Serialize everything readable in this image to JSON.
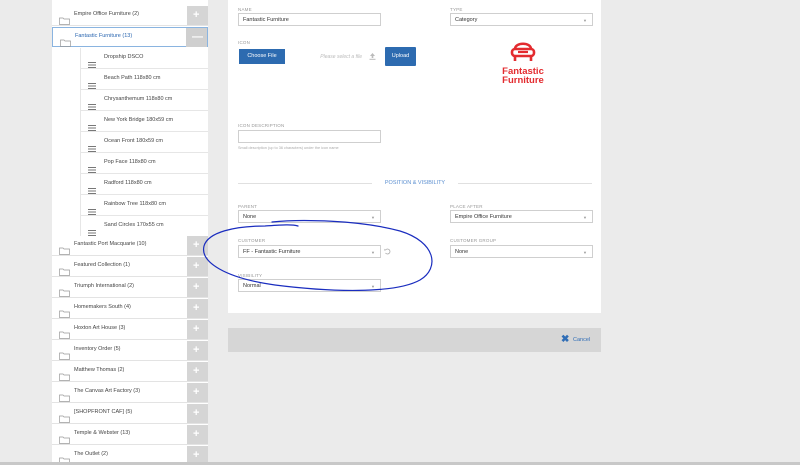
{
  "colors": {
    "accent": "#2d6bb0",
    "logo_red": "#e32b2f",
    "annotation_ink": "#1a2dbf"
  },
  "sidebar": {
    "categories_top": [
      {
        "label": "Empire Office Furniture (2)",
        "toggle": "+"
      },
      {
        "label": "Fantastic Furniture (13)",
        "toggle": "—",
        "active": true
      }
    ],
    "items": [
      "Dropship DSCO",
      "Beach Path 118x80 cm",
      "Chrysanthemum 118x80 cm",
      "New York Bridge 180x59 cm",
      "Ocean Front 180x59 cm",
      "Pop Face 118x80 cm",
      "Radford 118x80 cm",
      "Rainbow Tree 118x80 cm",
      "Sand Circles 170x55 cm"
    ],
    "categories_bottom": [
      {
        "label": "Fantastic Port Macquarie (10)",
        "toggle": "+"
      },
      {
        "label": "Featured Collection (1)",
        "toggle": "+"
      },
      {
        "label": "Triumph International (2)",
        "toggle": "+"
      },
      {
        "label": "Homemakers South (4)",
        "toggle": "+"
      },
      {
        "label": "Hoxton Art House (3)",
        "toggle": "+"
      },
      {
        "label": "Inventory Order (5)",
        "toggle": "+"
      },
      {
        "label": "Matthew Thomas (2)",
        "toggle": "+"
      },
      {
        "label": "The Canvas Art Factory (3)",
        "toggle": "+"
      },
      {
        "label": "[SHOPFRONT CAF] (5)",
        "toggle": "+"
      },
      {
        "label": "Temple & Webster (13)",
        "toggle": "+"
      },
      {
        "label": "The Outlet (2)",
        "toggle": "+"
      }
    ]
  },
  "form": {
    "name": {
      "label": "NAME",
      "value": "Fantastic Furniture"
    },
    "type": {
      "label": "TYPE",
      "value": "Category"
    },
    "icon": {
      "label": "ICON",
      "choose_label": "Choose File",
      "placeholder": "Please select a file",
      "upload_label": "Upload"
    },
    "logo": {
      "line1": "Fantastic",
      "line2": "Furniture"
    },
    "icon_description": {
      "label": "ICON DESCRIPTION",
      "value": "",
      "help": "Small description (up to 36 characters) under the icon name"
    },
    "section_title": "POSITION & VISIBILITY",
    "parent": {
      "label": "PARENT",
      "value": "None"
    },
    "place_after": {
      "label": "PLACE AFTER",
      "value": "Empire Office Furniture"
    },
    "customer": {
      "label": "CUSTOMER",
      "value": "FF - Fantastic Furniture"
    },
    "customer_group": {
      "label": "CUSTOMER GROUP",
      "value": "None"
    },
    "visibility": {
      "label": "VISIBILITY",
      "value": "Normal"
    }
  },
  "actions": {
    "cancel_label": "Cancel"
  }
}
